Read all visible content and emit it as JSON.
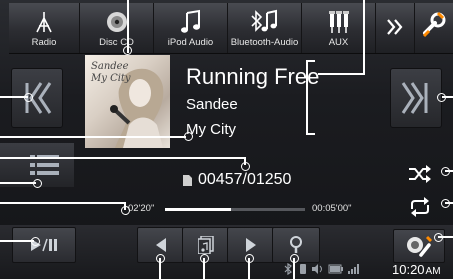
{
  "source_tabs": [
    {
      "label": "Radio",
      "icon": "antenna-icon"
    },
    {
      "label": "Disc CD",
      "icon": "disc-icon"
    },
    {
      "label": "iPod Audio",
      "icon": "music-note-icon"
    },
    {
      "label": "Bluetooth-Audio",
      "icon": "bluetooth-audio-icon"
    },
    {
      "label": "AUX",
      "icon": "aux-plug-icon"
    }
  ],
  "more_icon": "double-chevron-right-icon",
  "settings_icon": "wrench-icon",
  "track": {
    "title": "Running Free",
    "artist": "Sandee",
    "album": "My City",
    "album_art_text": "Sandee My City",
    "counter": "00457/01250"
  },
  "progress": {
    "elapsed": "02'20\"",
    "total": "00:05'00\"",
    "fraction": 0.47
  },
  "clock": "10:20",
  "clock_ampm": "AM",
  "colors": {
    "accent": "#ffffff",
    "background": "#1b1c20"
  }
}
